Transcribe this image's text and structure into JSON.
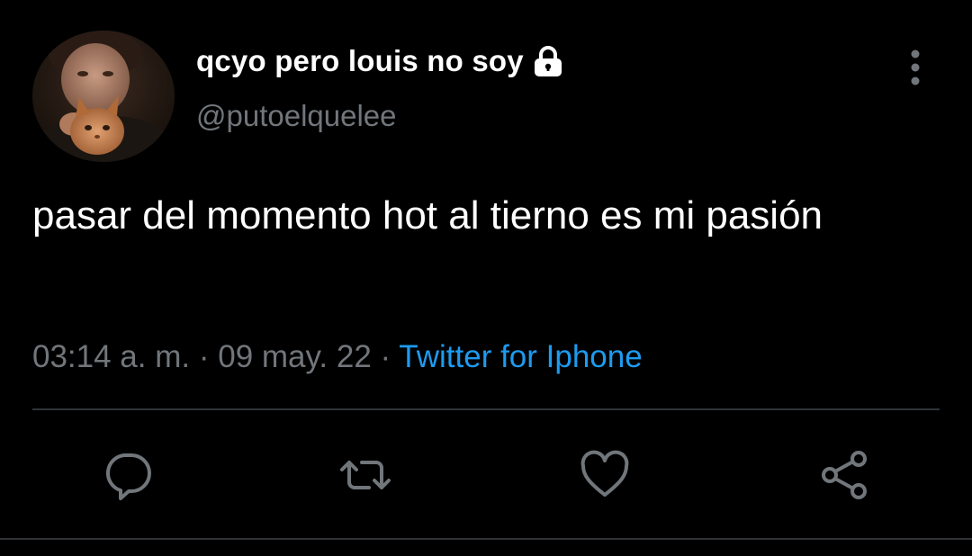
{
  "tweet": {
    "display_name": "qcyo pero louis no soy",
    "handle": "@putoelquelee",
    "text": "pasar del momento hot al tierno es mi pasión",
    "time": "03:14 a. m.",
    "separator": "·",
    "date": "09 may. 22",
    "source": "Twitter for Iphone"
  },
  "icons": {
    "lock": "lock-icon",
    "more": "more-vertical-icon",
    "reply": "reply-icon",
    "retweet": "retweet-icon",
    "like": "heart-icon",
    "share": "share-icon"
  },
  "colors": {
    "background": "#000000",
    "text": "#ffffff",
    "secondary": "#71767b",
    "link": "#1d9bf0",
    "divider": "#2f3336"
  }
}
